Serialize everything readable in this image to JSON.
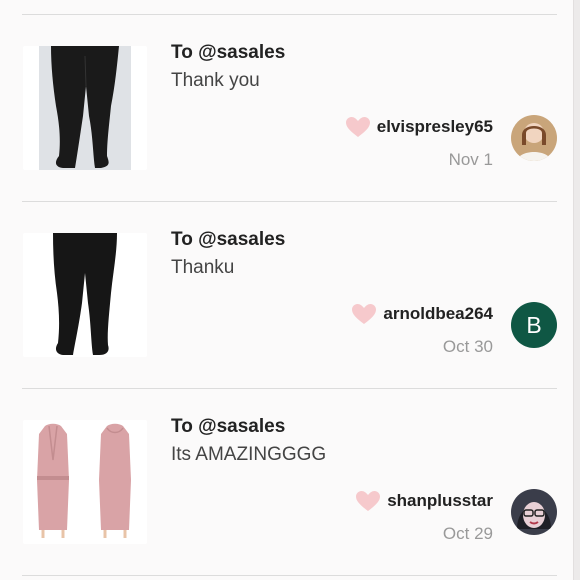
{
  "feed": {
    "items": [
      {
        "to_line": "To @sasales",
        "message": "Thank you",
        "username": "elvispresley65",
        "date": "Nov 1",
        "avatar_letter": ""
      },
      {
        "to_line": "To @sasales",
        "message": "Thanku",
        "username": "arnoldbea264",
        "date": "Oct 30",
        "avatar_letter": "B"
      },
      {
        "to_line": "To @sasales",
        "message": "Its AMAZINGGGG",
        "username": "shanplusstar",
        "date": "Oct 29",
        "avatar_letter": ""
      }
    ]
  },
  "colors": {
    "heart": "#f6c9cc",
    "avatar_letter_bg": "#0f5744",
    "divider": "#dcdcdc"
  },
  "icons": {
    "like": "heart-icon"
  }
}
